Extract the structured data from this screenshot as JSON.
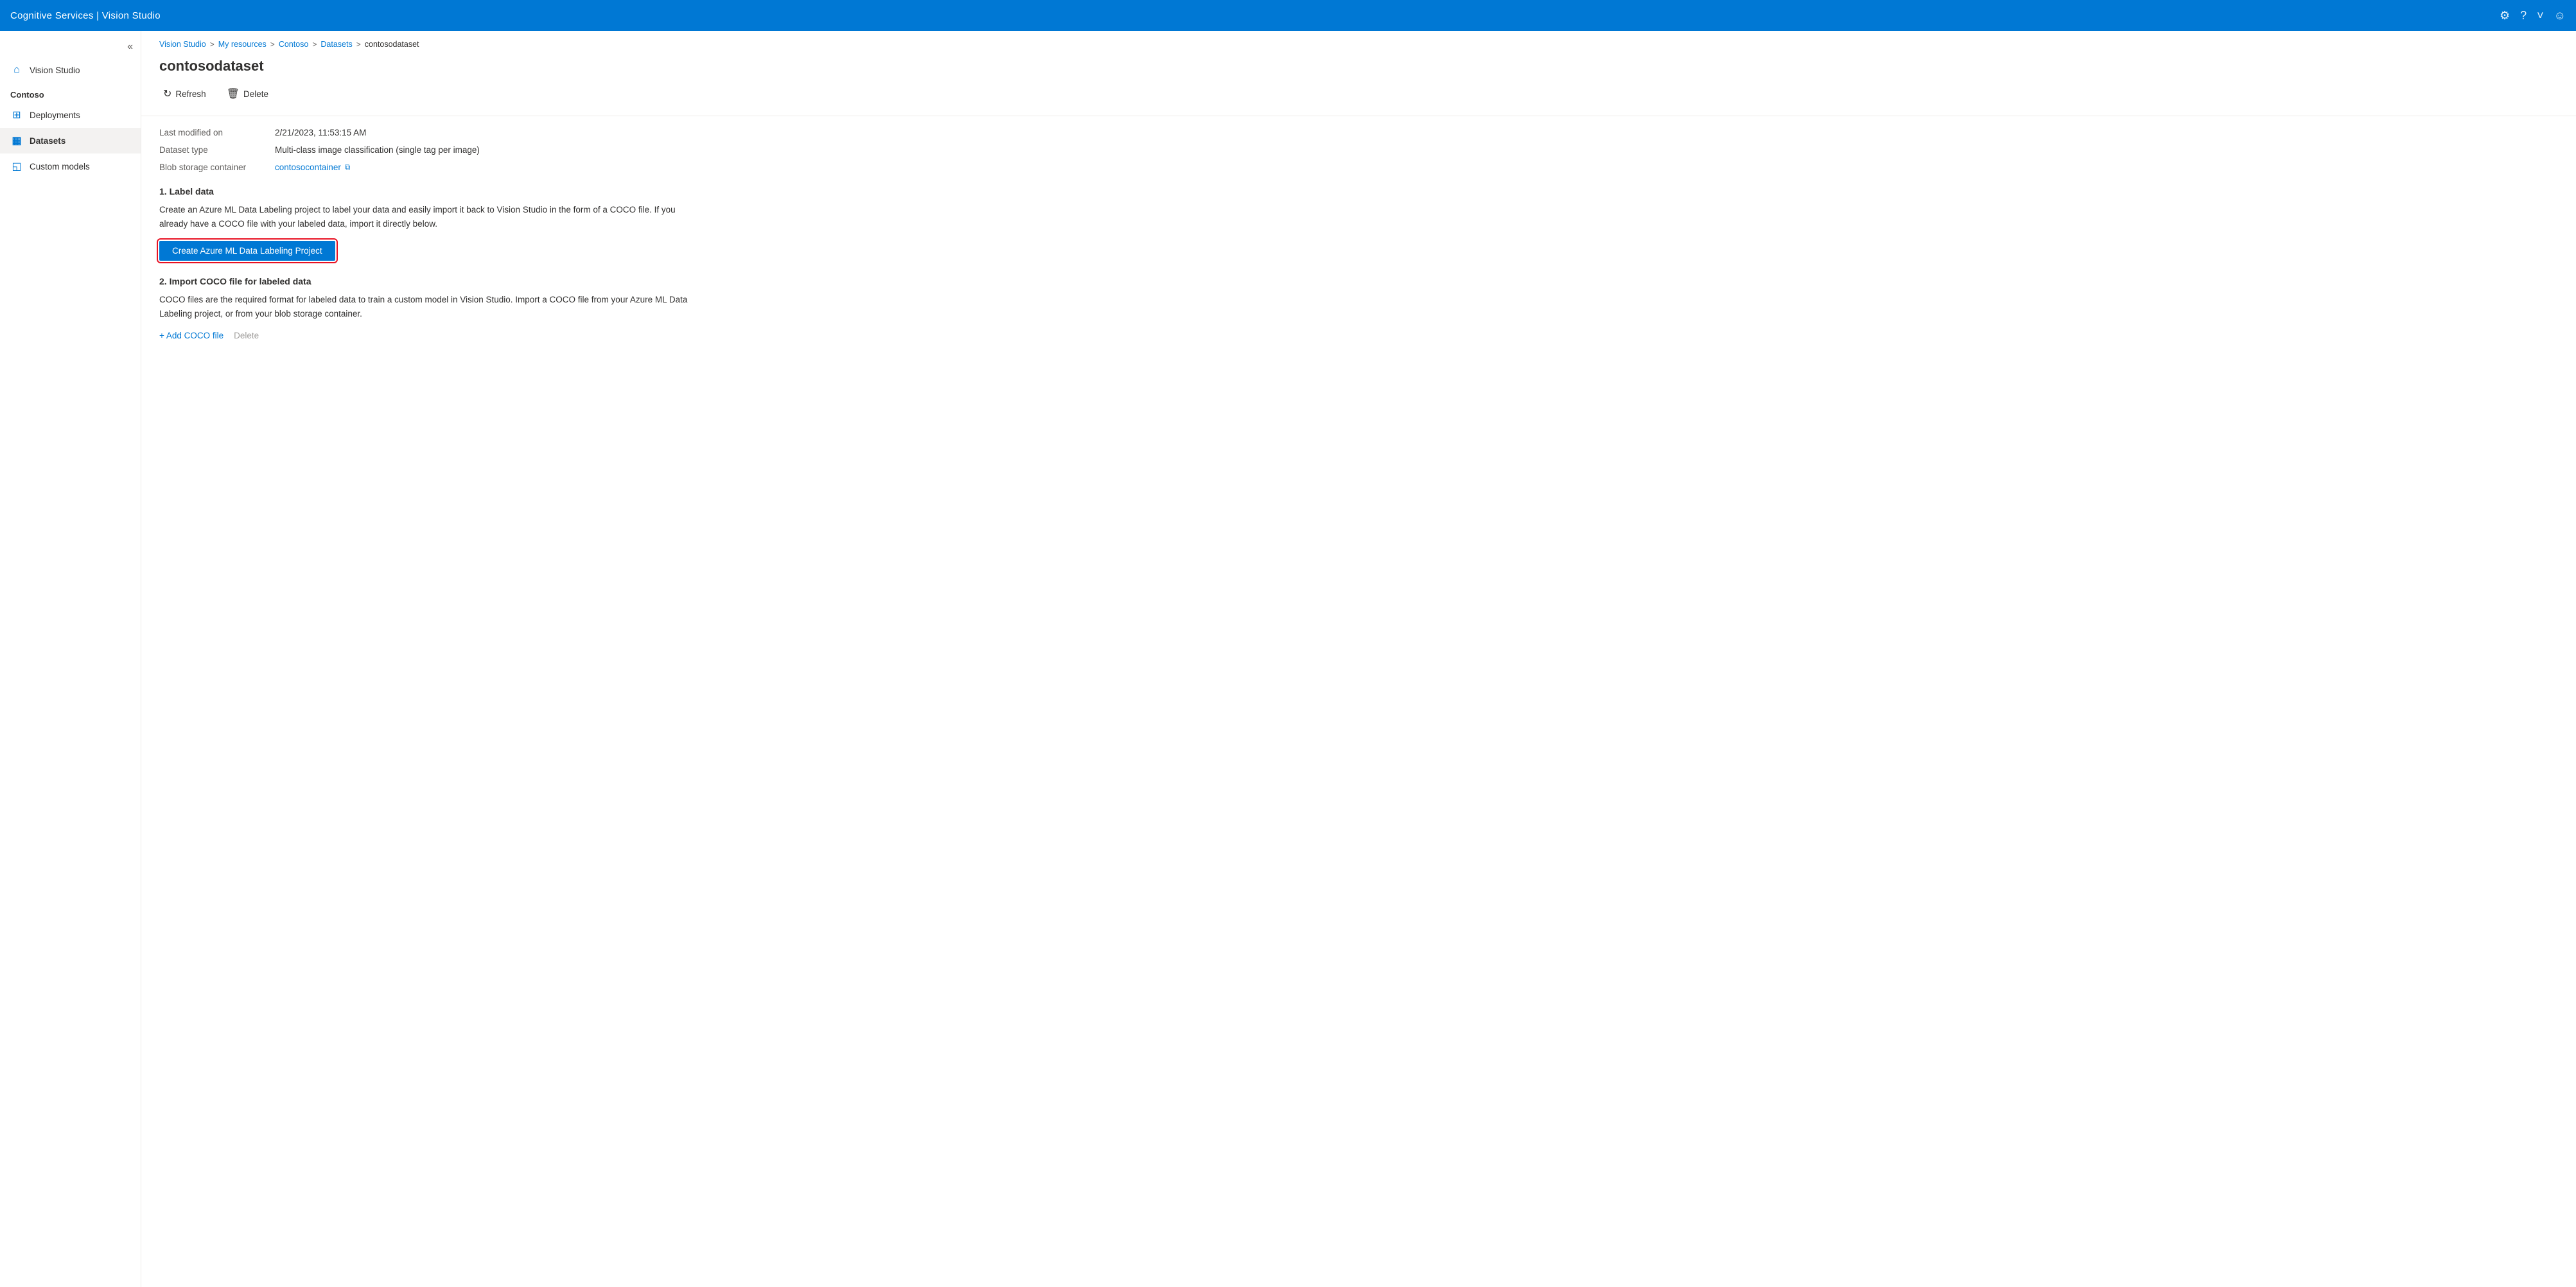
{
  "app": {
    "title": "Cognitive Services | Vision Studio"
  },
  "topnav": {
    "settings_icon": "⚙",
    "help_icon": "?",
    "chevron_icon": "˅",
    "user_icon": "☺"
  },
  "sidebar": {
    "collapse_label": "«",
    "section_label": "Contoso",
    "items": [
      {
        "id": "vision-studio",
        "label": "Vision Studio",
        "icon": "⌂"
      },
      {
        "id": "deployments",
        "label": "Deployments",
        "icon": "⊞"
      },
      {
        "id": "datasets",
        "label": "Datasets",
        "icon": "▦",
        "active": true
      },
      {
        "id": "custom-models",
        "label": "Custom models",
        "icon": "◱"
      }
    ]
  },
  "breadcrumb": {
    "items": [
      {
        "label": "Vision Studio",
        "link": true
      },
      {
        "label": "My resources",
        "link": true
      },
      {
        "label": "Contoso",
        "link": true
      },
      {
        "label": "Datasets",
        "link": true
      },
      {
        "label": "contosodataset",
        "link": false
      }
    ],
    "separator": ">"
  },
  "page": {
    "title": "contosodataset"
  },
  "toolbar": {
    "refresh_label": "Refresh",
    "refresh_icon": "↻",
    "delete_label": "Delete",
    "delete_icon": "🗑"
  },
  "details": {
    "rows": [
      {
        "label": "Last modified on",
        "value": "2/21/2023, 11:53:15 AM",
        "type": "text"
      },
      {
        "label": "Dataset type",
        "value": "Multi-class image classification (single tag per image)",
        "type": "text"
      },
      {
        "label": "Blob storage container",
        "value": "contosocontainer",
        "type": "link"
      }
    ]
  },
  "section1": {
    "title": "1. Label data",
    "description": "Create an Azure ML Data Labeling project to label your data and easily import it back to Vision Studio in the form of a COCO file. If you already have a COCO file with your labeled data, import it directly below.",
    "button_label": "Create Azure ML Data Labeling Project"
  },
  "section2": {
    "title": "2. Import COCO file for labeled data",
    "description": "COCO files are the required format for labeled data to train a custom model in Vision Studio. Import a COCO file from your Azure ML Data Labeling project, or from your blob storage container.",
    "add_coco_label": "+ Add COCO file",
    "delete_label": "Delete"
  }
}
